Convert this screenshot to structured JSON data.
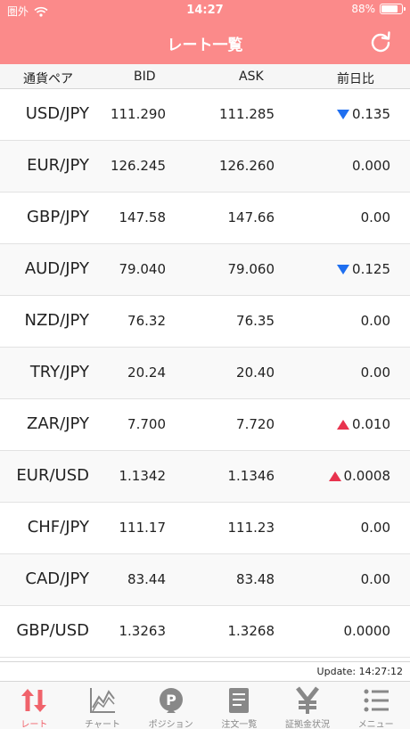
{
  "status": {
    "carrier": "圏外",
    "time": "14:27",
    "battery": "88%",
    "battery_level": 0.88
  },
  "header": {
    "title": "レート一覧"
  },
  "columns": {
    "pair": "通貨ペア",
    "bid": "BID",
    "ask": "ASK",
    "change": "前日比"
  },
  "rates": [
    {
      "pair": "USD/JPY",
      "bid": "111.290",
      "ask": "111.285",
      "change": "0.135",
      "dir": "down"
    },
    {
      "pair": "EUR/JPY",
      "bid": "126.245",
      "ask": "126.260",
      "change": "0.000",
      "dir": "none"
    },
    {
      "pair": "GBP/JPY",
      "bid": "147.58",
      "ask": "147.66",
      "change": "0.00",
      "dir": "none"
    },
    {
      "pair": "AUD/JPY",
      "bid": "79.040",
      "ask": "79.060",
      "change": "0.125",
      "dir": "down"
    },
    {
      "pair": "NZD/JPY",
      "bid": "76.32",
      "ask": "76.35",
      "change": "0.00",
      "dir": "none"
    },
    {
      "pair": "TRY/JPY",
      "bid": "20.24",
      "ask": "20.40",
      "change": "0.00",
      "dir": "none"
    },
    {
      "pair": "ZAR/JPY",
      "bid": "7.700",
      "ask": "7.720",
      "change": "0.010",
      "dir": "up"
    },
    {
      "pair": "EUR/USD",
      "bid": "1.1342",
      "ask": "1.1346",
      "change": "0.0008",
      "dir": "up"
    },
    {
      "pair": "CHF/JPY",
      "bid": "111.17",
      "ask": "111.23",
      "change": "0.00",
      "dir": "none"
    },
    {
      "pair": "CAD/JPY",
      "bid": "83.44",
      "ask": "83.48",
      "change": "0.00",
      "dir": "none"
    },
    {
      "pair": "GBP/USD",
      "bid": "1.3263",
      "ask": "1.3268",
      "change": "0.0000",
      "dir": "none"
    }
  ],
  "update": {
    "label": "Update: 14:27:12"
  },
  "tabs": [
    {
      "label": "レート",
      "icon": "rate-arrows-icon",
      "active": true
    },
    {
      "label": "チャート",
      "icon": "chart-icon",
      "active": false
    },
    {
      "label": "ポジション",
      "icon": "position-icon",
      "active": false
    },
    {
      "label": "注文一覧",
      "icon": "order-list-icon",
      "active": false
    },
    {
      "label": "証拠金状況",
      "icon": "yen-icon",
      "active": false
    },
    {
      "label": "メニュー",
      "icon": "menu-icon",
      "active": false
    }
  ],
  "colors": {
    "header": "#fb8a8a",
    "active_tab": "#f0636b",
    "down": "#1f6ff0",
    "up": "#e8334e"
  }
}
